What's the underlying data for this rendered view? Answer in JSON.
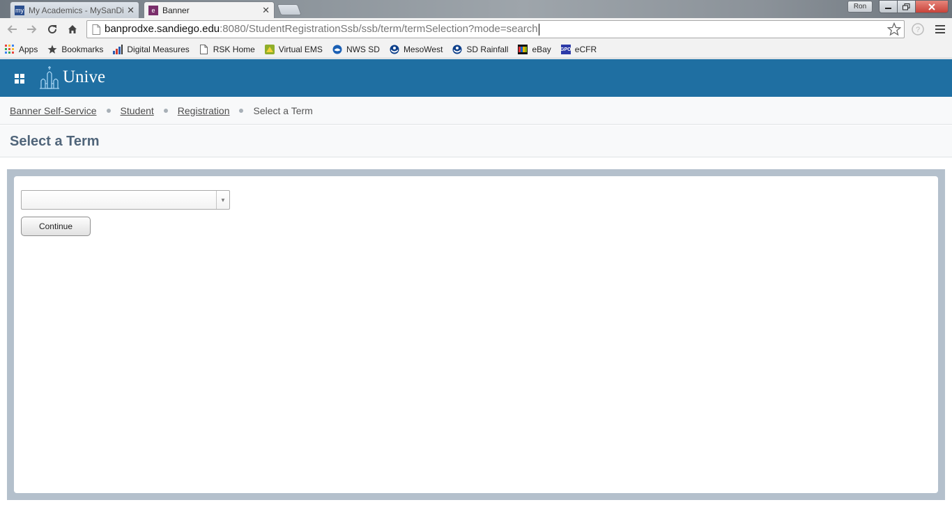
{
  "browser": {
    "tabs": [
      {
        "title": "My Academics - MySanDi",
        "favicon": "my",
        "active": false
      },
      {
        "title": "Banner",
        "favicon": "e",
        "active": true
      }
    ],
    "profile_name": "Ron",
    "url_host": "banprodxe.sandiego.edu",
    "url_rest": ":8080/StudentRegistrationSsb/ssb/term/termSelection?mode=search",
    "bookmarks": [
      {
        "label": "Apps",
        "icon": "apps-grid-icon"
      },
      {
        "label": "Bookmarks",
        "icon": "star-icon"
      },
      {
        "label": "Digital Measures",
        "icon": "bars-chart-icon"
      },
      {
        "label": "RSK Home",
        "icon": "page-icon"
      },
      {
        "label": "Virtual EMS",
        "icon": "ems-icon"
      },
      {
        "label": "NWS SD",
        "icon": "nws-icon"
      },
      {
        "label": "MesoWest",
        "icon": "noaa-icon"
      },
      {
        "label": "SD Rainfall",
        "icon": "noaa-icon"
      },
      {
        "label": "eBay",
        "icon": "ebay-icon"
      },
      {
        "label": "eCFR",
        "icon": "gpo-icon"
      }
    ]
  },
  "header": {
    "logo_text": "Unive"
  },
  "breadcrumb": {
    "items": [
      "Banner Self-Service",
      "Student",
      "Registration"
    ],
    "current": "Select a Term"
  },
  "page": {
    "title": "Select a Term",
    "term_select_value": "",
    "continue_label": "Continue"
  },
  "colors": {
    "header_bg": "#1f6fa2",
    "frame_bg": "#b4c0cc",
    "title_color": "#50657a"
  }
}
